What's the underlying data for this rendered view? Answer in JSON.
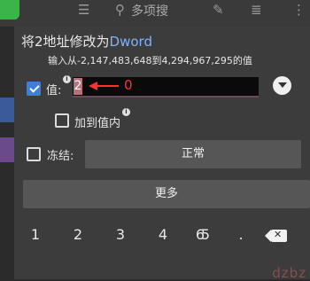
{
  "background": {
    "tab_text": "多项搜",
    "watermark": "dzbz"
  },
  "dialog": {
    "title_prefix": "将2地址修改为",
    "title_type": "Dword",
    "range_hint": "输入从-2,147,483,648到4,294,967,295的值",
    "value_label": "值:",
    "value_input": "2",
    "annotation_value": "0",
    "add_to_value_label": "加到值内",
    "freeze_label": "冻结:",
    "normal_button": "正常",
    "more_button": "更多",
    "value_checked": true,
    "add_checked": false,
    "freeze_checked": false
  },
  "keyboard": {
    "keys": [
      "1",
      "2",
      "3",
      "4",
      "5",
      "6",
      "."
    ]
  },
  "colors": {
    "checkbox_accent": "#3f7fd6",
    "annotation_red": "#ff3030",
    "type_blue": "#7fb3ff"
  }
}
